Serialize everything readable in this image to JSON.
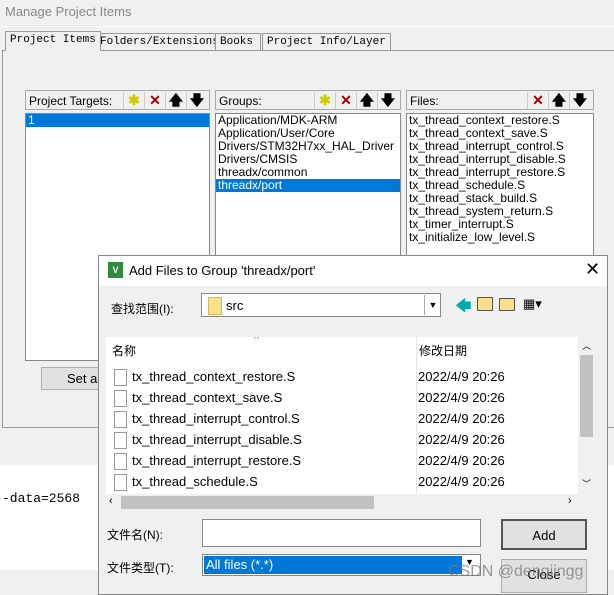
{
  "window": {
    "title": "Manage Project Items"
  },
  "tabs": [
    {
      "label": "Project Items"
    },
    {
      "label": "Folders/Extensions"
    },
    {
      "label": "Books"
    },
    {
      "label": "Project Info/Layer"
    }
  ],
  "targets": {
    "label": "Project Targets:",
    "items": [
      "1"
    ],
    "selected": "1",
    "set_button": "Set as"
  },
  "groups": {
    "label": "Groups:",
    "items": [
      "Application/MDK-ARM",
      "Application/User/Core",
      "Drivers/STM32H7xx_HAL_Driver",
      "Drivers/CMSIS",
      "threadx/common",
      "threadx/port"
    ],
    "selected": "threadx/port"
  },
  "files": {
    "label": "Files:",
    "items": [
      "tx_thread_context_restore.S",
      "tx_thread_context_save.S",
      "tx_thread_interrupt_control.S",
      "tx_thread_interrupt_disable.S",
      "tx_thread_interrupt_restore.S",
      "tx_thread_schedule.S",
      "tx_thread_stack_build.S",
      "tx_thread_system_return.S",
      "tx_timer_interrupt.S",
      "tx_initialize_low_level.S"
    ]
  },
  "background_text": "-data=2568",
  "dialog": {
    "title": "Add Files to Group 'threadx/port'",
    "look_in_label": "查找范围(I):",
    "look_in_value": "src",
    "columns": [
      "名称",
      "修改日期"
    ],
    "rows": [
      {
        "name": "tx_thread_context_restore.S",
        "date": "2022/4/9 20:26"
      },
      {
        "name": "tx_thread_context_save.S",
        "date": "2022/4/9 20:26"
      },
      {
        "name": "tx_thread_interrupt_control.S",
        "date": "2022/4/9 20:26"
      },
      {
        "name": "tx_thread_interrupt_disable.S",
        "date": "2022/4/9 20:26"
      },
      {
        "name": "tx_thread_interrupt_restore.S",
        "date": "2022/4/9 20:26"
      },
      {
        "name": "tx_thread_schedule.S",
        "date": "2022/4/9 20:26"
      }
    ],
    "filename_label": "文件名(N):",
    "filename_value": "",
    "filetype_label": "文件类型(T):",
    "filetype_value": "All files (*.*)",
    "add_button": "Add",
    "close_button": "Close"
  },
  "watermark": "CSDN @dengjingg",
  "colors": {
    "selection": "#0078d7",
    "delete": "#a00000"
  }
}
